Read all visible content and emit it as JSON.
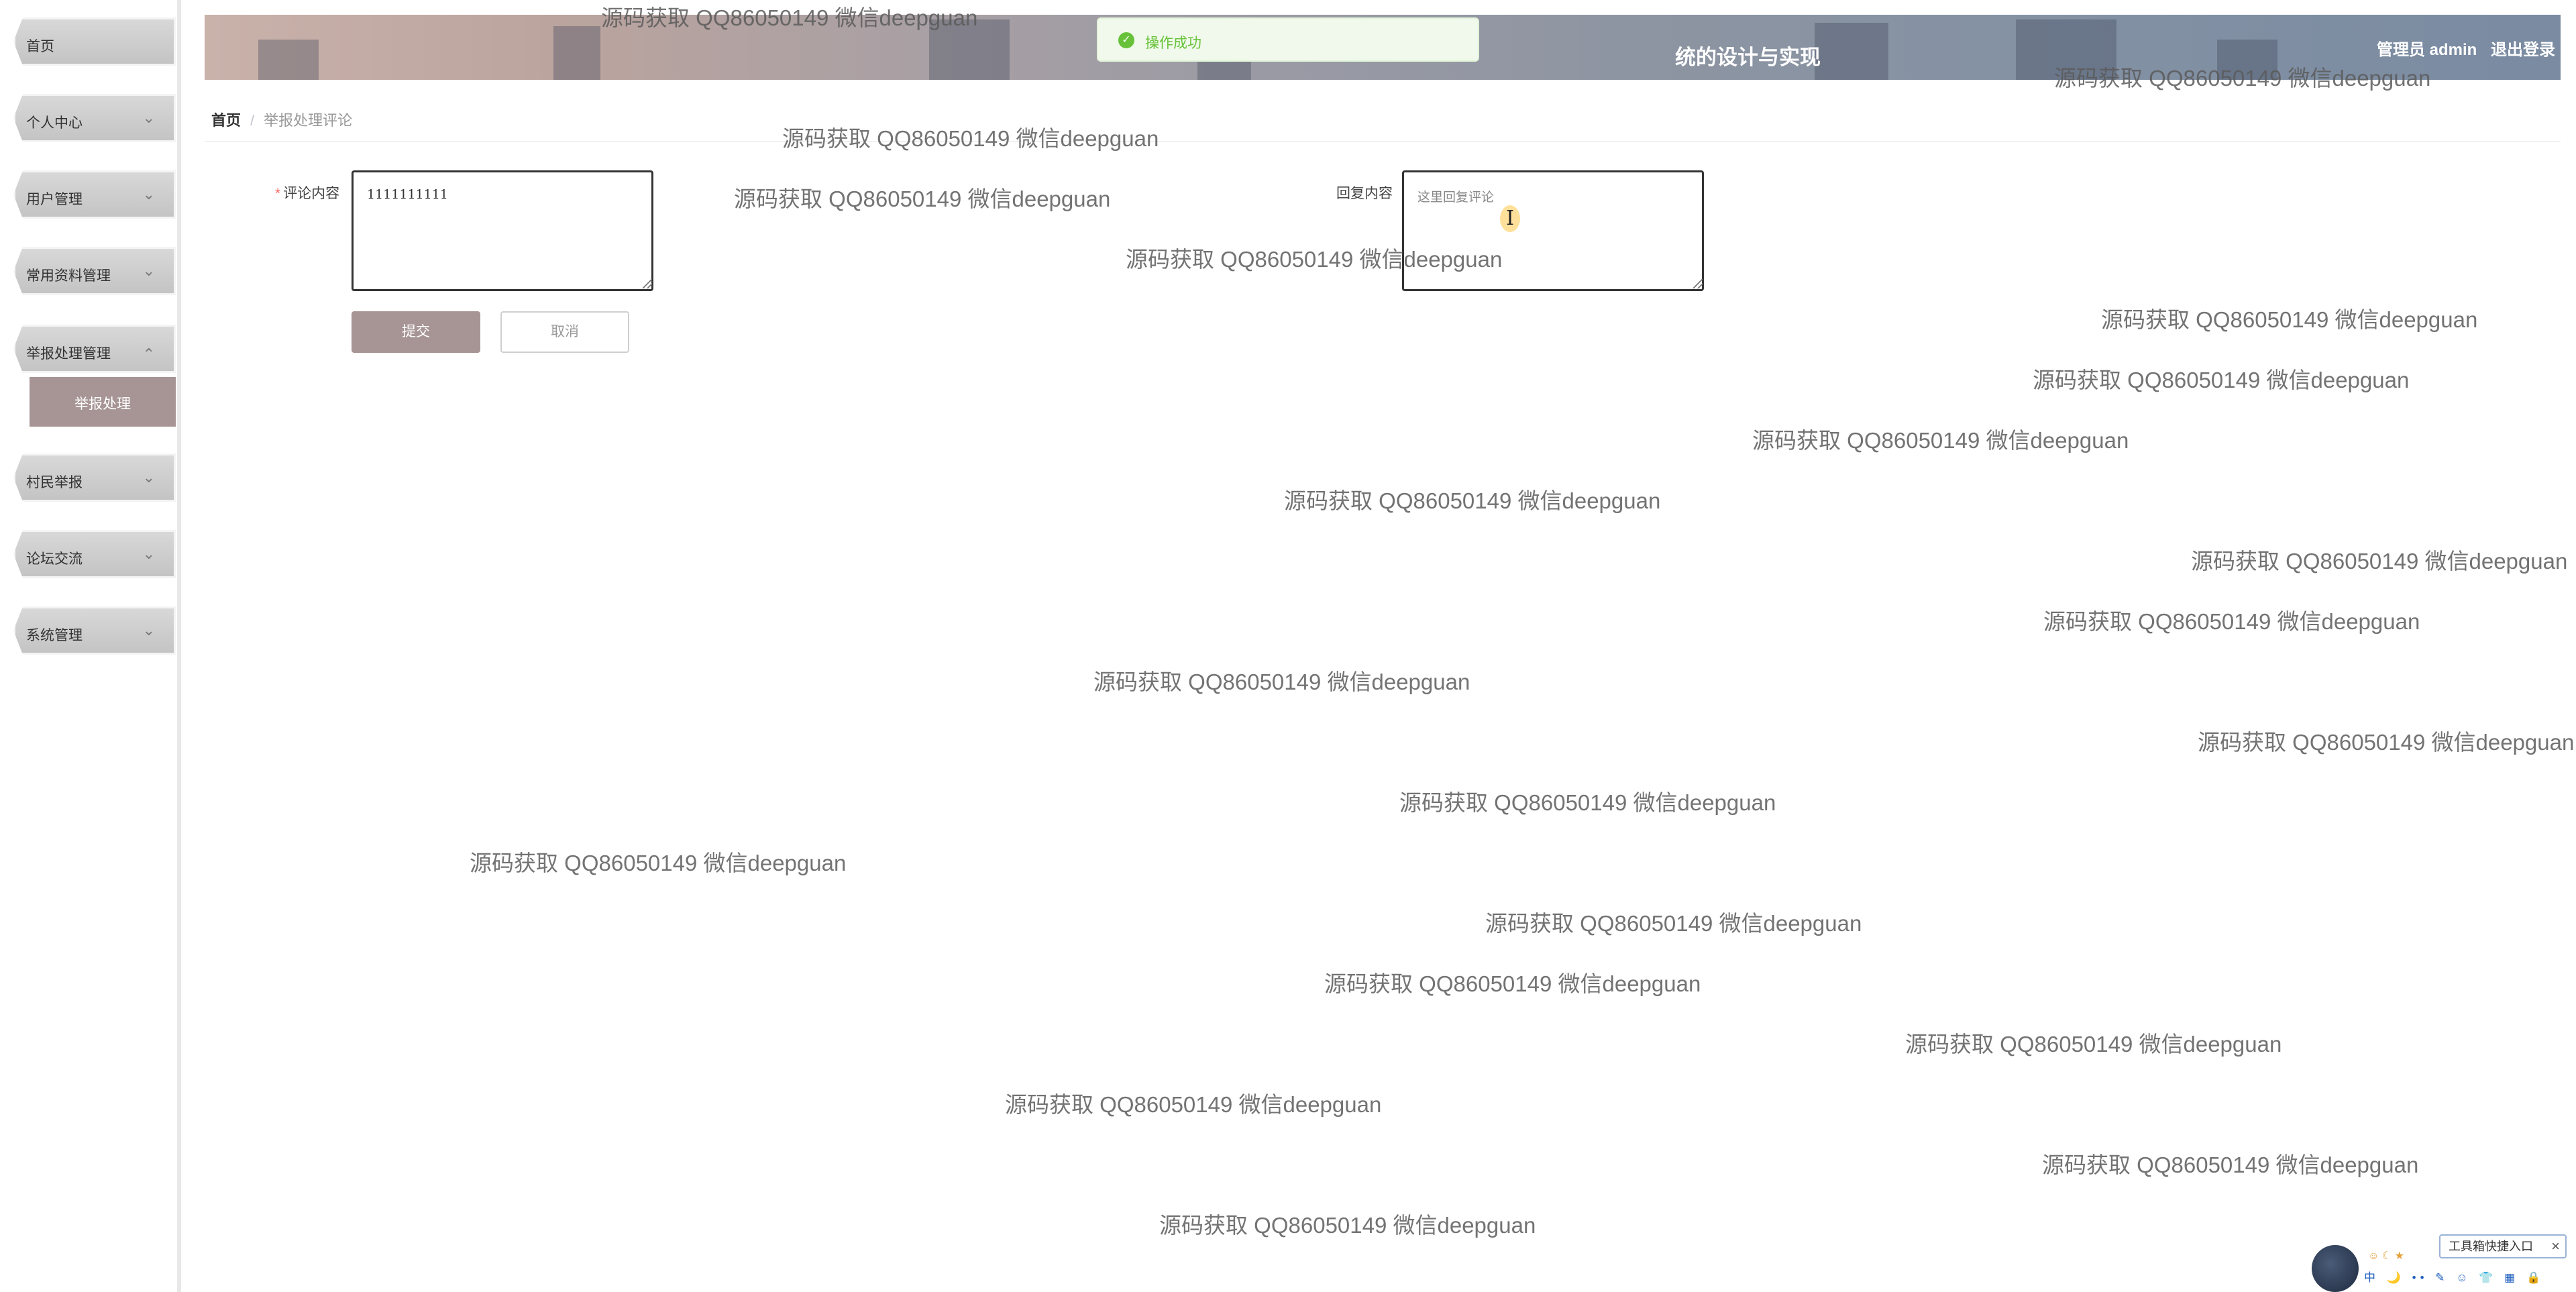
{
  "sidebar": {
    "items": [
      {
        "label": "首页"
      },
      {
        "label": "个人中心",
        "expanded": false
      },
      {
        "label": "用户管理",
        "expanded": false
      },
      {
        "label": "常用资料管理",
        "expanded": false
      },
      {
        "label": "举报处理管理",
        "expanded": true,
        "children": [
          {
            "label": "举报处理"
          }
        ]
      },
      {
        "label": "村民举报",
        "expanded": false
      },
      {
        "label": "论坛交流",
        "expanded": false
      },
      {
        "label": "系统管理",
        "expanded": false
      }
    ]
  },
  "header": {
    "title": "统的设计与实现",
    "user_label": "管理员 admin",
    "logout_label": "退出登录"
  },
  "toast": {
    "message": "操作成功"
  },
  "breadcrumb": {
    "home": "首页",
    "current": "举报处理评论"
  },
  "form": {
    "comment_label": "评论内容",
    "comment_value": "1111111111",
    "reply_label": "回复内容",
    "reply_placeholder": "这里回复评论",
    "submit_label": "提交",
    "cancel_label": "取消"
  },
  "watermark_text": "源码获取 QQ86050149 微信deepguan",
  "tool_widget": {
    "label": "工具箱快捷入口",
    "icons_row": "中 🌙 •• ✎ ☺ 👕 ▦ 🔒"
  },
  "colors": {
    "accent": "#a69594",
    "success": "#67c23a"
  }
}
